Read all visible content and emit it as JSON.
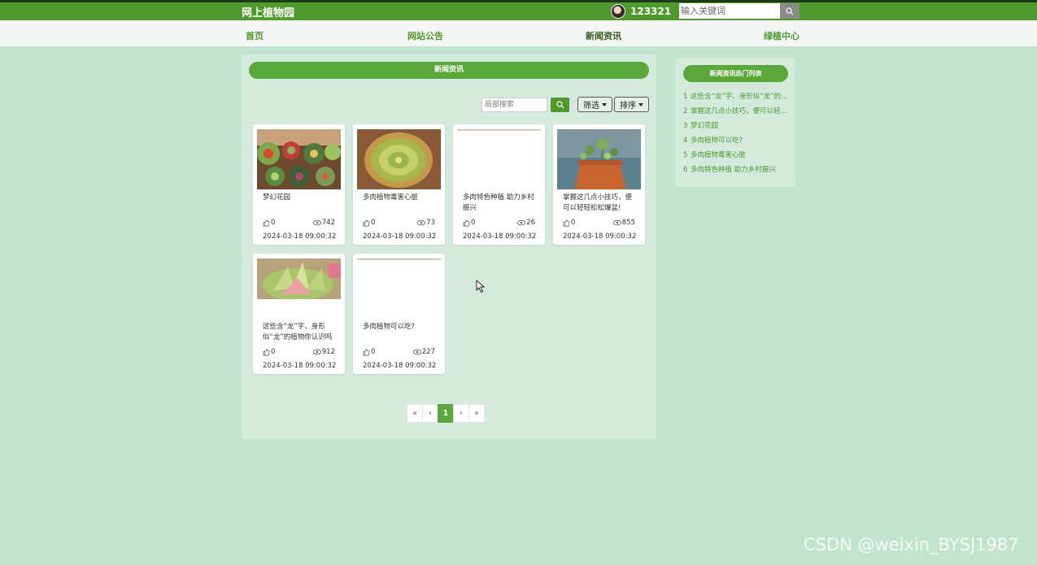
{
  "header": {
    "site_title": "网上植物园",
    "username": "123321",
    "search_placeholder": "输入关键词"
  },
  "nav": [
    "首页",
    "网站公告",
    "新闻资讯",
    "绿植中心"
  ],
  "main": {
    "section_title": "新闻资讯",
    "local_search_placeholder": "局部搜索",
    "filter_label": "筛选",
    "sort_label": "排序",
    "cards": [
      {
        "title": "梦幻花园",
        "likes": "0",
        "views": "742",
        "date": "2024-03-18 09:00:32",
        "image": "succulent-garden"
      },
      {
        "title": "多肉植物毒害心脏",
        "likes": "0",
        "views": "73",
        "date": "2024-03-18 09:00:32",
        "image": "succulent-rosette"
      },
      {
        "title": "多肉特色种植 助力乡村振兴",
        "likes": "0",
        "views": "26",
        "date": "2024-03-18 09:00:32",
        "image": "blank"
      },
      {
        "title": "掌握这几点小技巧，便可以轻轻松松爆盆!",
        "likes": "0",
        "views": "855",
        "date": "2024-03-18 09:00:32",
        "image": "succulent-pot"
      },
      {
        "title": "这些含“龙”字、身形似“龙”的植物你认识吗",
        "likes": "0",
        "views": "912",
        "date": "2024-03-18 09:00:32",
        "image": "succulent-closeup"
      },
      {
        "title": "多肉植物可以吃?",
        "likes": "0",
        "views": "227",
        "date": "2024-03-18 09:00:32",
        "image": "blank"
      }
    ],
    "pagination": {
      "first": "«",
      "prev": "‹",
      "current": "1",
      "next": "›",
      "last": "»"
    }
  },
  "sidebar": {
    "title": "新闻资讯热门列表",
    "items": [
      {
        "num": "1",
        "text": "这些含“龙”字、身形似“龙”的植物你认识吗"
      },
      {
        "num": "2",
        "text": "掌握这几点小技巧，便可以轻轻松松爆盆!"
      },
      {
        "num": "3",
        "text": "梦幻花园"
      },
      {
        "num": "4",
        "text": "多肉植物可以吃?"
      },
      {
        "num": "5",
        "text": "多肉植物毒害心脏"
      },
      {
        "num": "6",
        "text": "多肉特色种植 助力乡村振兴"
      }
    ]
  },
  "watermark": "CSDN @weixin_BYSJ1987"
}
